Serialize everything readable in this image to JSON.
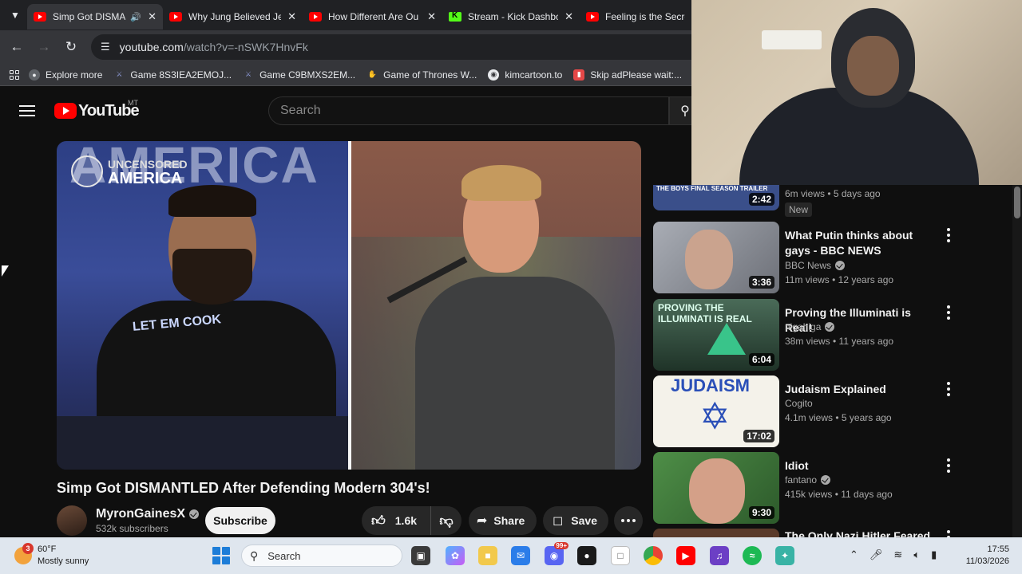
{
  "browser": {
    "tabs": [
      {
        "title": "Simp Got DISMANTLED",
        "active": true,
        "audio": true,
        "icon": "youtube-icon"
      },
      {
        "title": "Why Jung Believed Je",
        "active": false,
        "icon": "youtube-icon"
      },
      {
        "title": "How Different Are Ou",
        "active": false,
        "icon": "youtube-icon"
      },
      {
        "title": "Stream - Kick Dashbo",
        "active": false,
        "icon": "kick-icon"
      },
      {
        "title": "Feeling is the Secret",
        "active": false,
        "icon": "youtube-icon"
      }
    ],
    "url_host": "youtube.com",
    "url_path": "/watch?v=-nSWK7HnvFk",
    "bookmarks": [
      {
        "label": "Explore more",
        "icon": "explore-icon",
        "color": "#8ab4f8"
      },
      {
        "label": "Game 8S3IEA2EMOJ...",
        "icon": "game-icon",
        "color": "#8e9bd8"
      },
      {
        "label": "Game C9BMXS2EM...",
        "icon": "game-icon",
        "color": "#8e9bd8"
      },
      {
        "label": "Game of Thrones W...",
        "icon": "hand-icon",
        "color": "#e89b3c"
      },
      {
        "label": "kimcartoon.to",
        "icon": "globe-icon",
        "color": "#e8eaed"
      },
      {
        "label": "Skip adPlease wait:...",
        "icon": "bookmark-icon",
        "color": "#e54848"
      }
    ]
  },
  "youtube": {
    "logo_text": "YouTube",
    "region": "MT",
    "search_placeholder": "Search",
    "player": {
      "banner_text": "AMERICA",
      "logo_top": "UNCENSORED",
      "logo_bottom": "AMERICA",
      "shirt_text": "LET EM COOK"
    },
    "video": {
      "title": "Simp Got DISMANTLED After Defending Modern 304's!",
      "channel": "MyronGainesX",
      "subscribers": "532k subscribers",
      "subscribe_label": "Subscribe",
      "likes": "1.6k",
      "share_label": "Share",
      "save_label": "Save"
    },
    "sidebar": [
      {
        "title": "",
        "channel": "",
        "meta": "6m views • 5 days ago",
        "badge": "New",
        "duration": "2:42",
        "thumb_text": "THE BOYS FINAL SEASON TRAILER",
        "thumb_color": "#3a4f8a"
      },
      {
        "title": "What Putin thinks about gays - BBC NEWS",
        "channel": "BBC News",
        "verified": true,
        "meta": "11m views • 12 years ago",
        "duration": "3:36",
        "thumb_text": "",
        "thumb_color": "#8d9098"
      },
      {
        "title": "Proving the Illuminati is Real!",
        "channel": "nigahiga",
        "verified": true,
        "meta": "38m views • 11 years ago",
        "duration": "6:04",
        "thumb_text": "PROVING THE ILLUMINATI IS REAL",
        "thumb_color": "#2f4a3a"
      },
      {
        "title": "Judaism Explained",
        "channel": "Cogito",
        "verified": false,
        "meta": "4.1m views • 5 years ago",
        "duration": "17:02",
        "thumb_text": "JUDAISM",
        "thumb_color": "#f4f2ea"
      },
      {
        "title": "Idiot",
        "channel": "fantano",
        "verified": true,
        "meta": "415k views • 11 days ago",
        "duration": "9:30",
        "thumb_text": "",
        "thumb_color": "#3d7a3b"
      },
      {
        "title": "The Only Nazi Hitler Feared",
        "channel": "",
        "meta": "",
        "duration": "",
        "thumb_text": "",
        "thumb_color": "#5a3a2a"
      }
    ]
  },
  "taskbar": {
    "weather_temp": "60°F",
    "weather_desc": "Mostly sunny",
    "weather_badge": "3",
    "search_label": "Search",
    "time": "17:55",
    "date": "11/03/2026",
    "discord_badge": "99+"
  }
}
